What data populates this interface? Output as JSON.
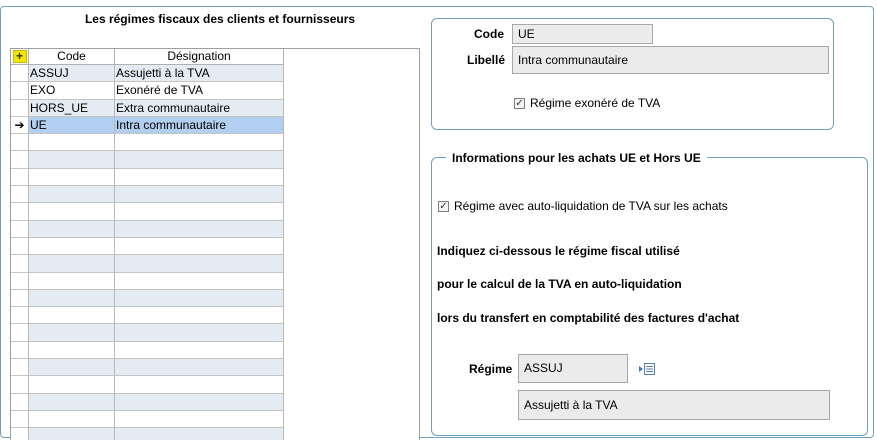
{
  "grid": {
    "title": "Les régimes fiscaux des clients et fournisseurs",
    "columns": {
      "code": "Code",
      "designation": "Désignation"
    },
    "rows": [
      {
        "code": "ASSUJ",
        "designation": "Assujetti à la TVA"
      },
      {
        "code": "EXO",
        "designation": "Exonéré de TVA"
      },
      {
        "code": "HORS_UE",
        "designation": "Extra communautaire"
      },
      {
        "code": "UE",
        "designation": "Intra communautaire"
      }
    ],
    "current_row_marker": "➔"
  },
  "detail": {
    "code_label": "Code",
    "code_value": "UE",
    "libelle_label": "Libellé",
    "libelle_value": "Intra communautaire",
    "exonere_label": "Régime exonéré de TVA",
    "exonere_checked": true
  },
  "achats": {
    "legend": "Informations pour les achats UE et Hors UE",
    "autoliq_label": "Régime avec auto-liquidation de TVA sur les achats",
    "autoliq_checked": true,
    "info_line1": "Indiquez ci-dessous le régime fiscal utilisé",
    "info_line2": "pour le calcul de la TVA en auto-liquidation",
    "info_line3": "lors du transfert en comptabilité des factures d'achat",
    "regime_label": "Régime",
    "regime_code": "ASSUJ",
    "regime_designation": "Assujetti à la TVA"
  },
  "icons": {
    "add": "add-row-icon",
    "current_row": "current-row-arrow-icon",
    "check": "checkmark-icon",
    "lookup": "lookup-list-icon"
  },
  "colors": {
    "accent_border": "#6f9fbe",
    "row_alt": "#e4ebf3",
    "row_selected": "#b2cef0",
    "add_icon": "#f2e600"
  }
}
